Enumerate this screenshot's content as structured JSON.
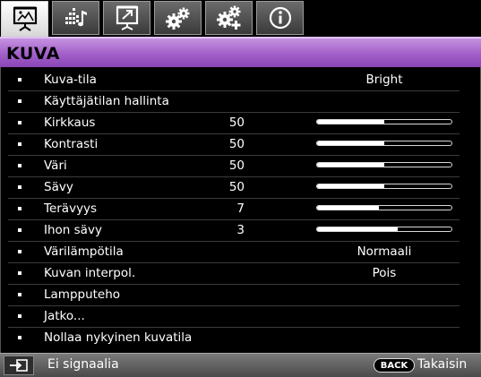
{
  "tabs": [
    {
      "icon": "picture-icon",
      "active": true
    },
    {
      "icon": "audio-equalizer-icon",
      "active": false
    },
    {
      "icon": "screen-display-icon",
      "active": false
    },
    {
      "icon": "gears-icon",
      "active": false
    },
    {
      "icon": "gears-plus-icon",
      "active": false
    },
    {
      "icon": "info-icon",
      "active": false
    }
  ],
  "header": {
    "title": "KUVA"
  },
  "menu": [
    {
      "label": "Kuva-tila",
      "text_value": "Bright"
    },
    {
      "label": "Käyttäjätilan hallinta"
    },
    {
      "label": "Kirkkaus",
      "value": "50",
      "level": 0.5
    },
    {
      "label": "Kontrasti",
      "value": "50",
      "level": 0.5
    },
    {
      "label": "Väri",
      "value": "50",
      "level": 0.5
    },
    {
      "label": "Sävy",
      "value": "50",
      "level": 0.5
    },
    {
      "label": "Terävyys",
      "value": "7",
      "level": 0.46
    },
    {
      "label": "Ihon sävy",
      "value": "3",
      "level": 0.6
    },
    {
      "label": "Värilämpötila",
      "text_value": "Normaali"
    },
    {
      "label": "Kuvan interpol.",
      "text_value": "Pois"
    },
    {
      "label": "Lampputeho"
    },
    {
      "label": "Jatko..."
    },
    {
      "label": "Nollaa nykyinen kuvatila"
    }
  ],
  "footer": {
    "source_icon": "input-source-icon",
    "status": "Ei signaalia",
    "back_button": "BACK",
    "back_label": "Takaisin"
  }
}
